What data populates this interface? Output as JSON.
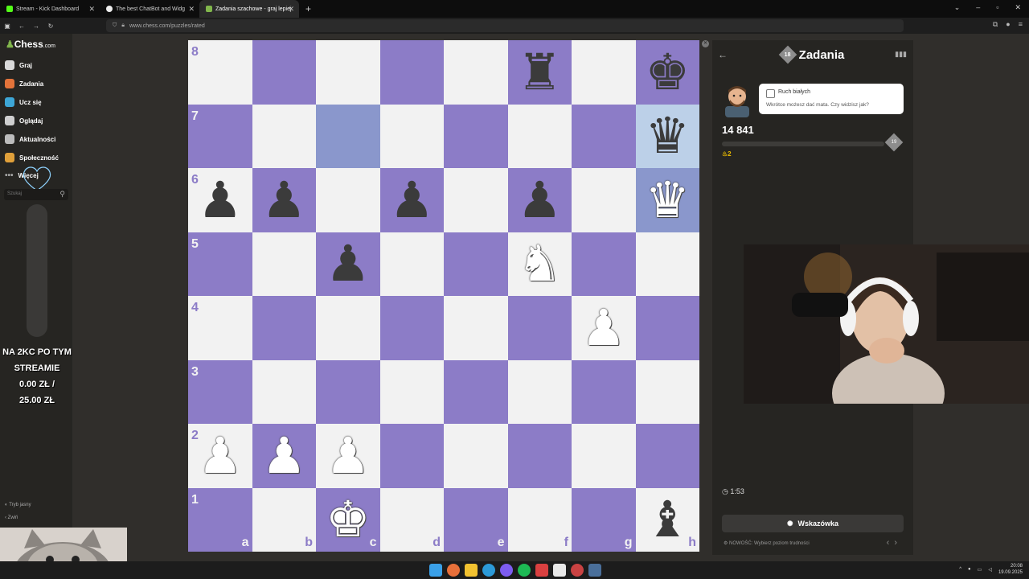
{
  "browser": {
    "tabs": [
      {
        "label": "Stream - Kick Dashboard",
        "color": "#53fc18"
      },
      {
        "label": "The best ChatBot and Widg",
        "color": "#ffffff"
      },
      {
        "label": "Zadania szachowe - graj lepiej",
        "color": "#81b64c"
      }
    ],
    "url": "www.chess.com/puzzles/rated"
  },
  "sidebar": {
    "logo_main": "Chess",
    "logo_suffix": ".com",
    "items": [
      {
        "label": "Graj",
        "color": "#d9d9d9"
      },
      {
        "label": "Zadania",
        "color": "#e3733a"
      },
      {
        "label": "Ucz się",
        "color": "#3da6d6"
      },
      {
        "label": "Oglądaj",
        "color": "#cfcfcf"
      },
      {
        "label": "Aktualności",
        "color": "#bcbcbc"
      },
      {
        "label": "Społeczność",
        "color": "#e0a03a"
      },
      {
        "label": "Więcej",
        "color": "#888888"
      }
    ],
    "search_placeholder": "Szukaj",
    "bottom": [
      "Tryb jasny",
      "Zwiń"
    ]
  },
  "donation": {
    "line1": "NA 2KC PO TYM",
    "line2": "STREAMIE",
    "line3": "0.00 ZŁ /",
    "line4": "25.00 ZŁ",
    "progress": 0
  },
  "board": {
    "ranks": [
      "8",
      "7",
      "6",
      "5",
      "4",
      "3",
      "2",
      "1"
    ],
    "files": [
      "a",
      "b",
      "c",
      "d",
      "e",
      "f",
      "g",
      "h"
    ],
    "pieces": [
      {
        "sq": "f8",
        "color": "black",
        "glyph": "♜"
      },
      {
        "sq": "h8",
        "color": "black",
        "glyph": "♚"
      },
      {
        "sq": "h7",
        "color": "black",
        "glyph": "♛"
      },
      {
        "sq": "a6",
        "color": "black",
        "glyph": "♟"
      },
      {
        "sq": "b6",
        "color": "black",
        "glyph": "♟"
      },
      {
        "sq": "d6",
        "color": "black",
        "glyph": "♟"
      },
      {
        "sq": "f6",
        "color": "black",
        "glyph": "♟"
      },
      {
        "sq": "h6",
        "color": "white",
        "glyph": "♛"
      },
      {
        "sq": "c5",
        "color": "black",
        "glyph": "♟"
      },
      {
        "sq": "f5",
        "color": "white",
        "glyph": "♞"
      },
      {
        "sq": "g4",
        "color": "white",
        "glyph": "♟"
      },
      {
        "sq": "a2",
        "color": "white",
        "glyph": "♟"
      },
      {
        "sq": "b2",
        "color": "white",
        "glyph": "♟"
      },
      {
        "sq": "c2",
        "color": "white",
        "glyph": "♟"
      },
      {
        "sq": "c1",
        "color": "white",
        "glyph": "♚"
      },
      {
        "sq": "h1",
        "color": "black",
        "glyph": "♝"
      }
    ],
    "highlights": [
      "c7",
      "h6"
    ],
    "highlights_light": [
      "h7"
    ]
  },
  "panel": {
    "title": "Zadania",
    "badge": "18",
    "bubble_title": "Ruch białych",
    "bubble_text": "Wkrótce możesz dać mata. Czy widzisz jak?",
    "rating": "14 841",
    "rating_badge": "19",
    "streak": "2",
    "timer": "1:53",
    "hint": "Wskazówka",
    "news": "NOWOŚĆ: Wybierz poziom trudności"
  },
  "taskbar": {
    "time": "20:08",
    "date": "19.09.2025"
  }
}
